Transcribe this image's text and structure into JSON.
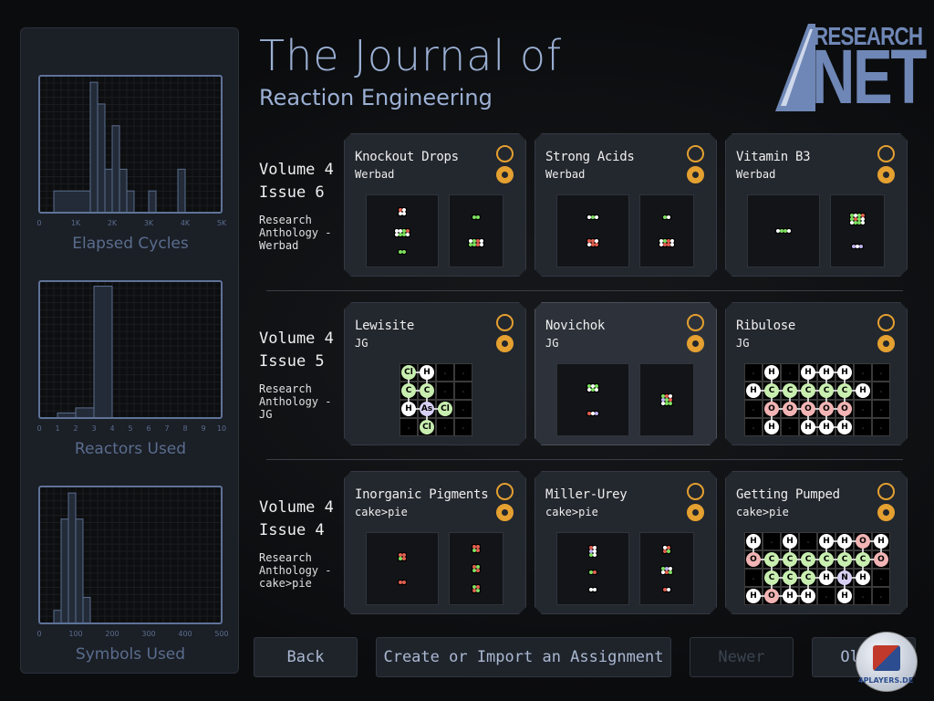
{
  "header": {
    "title": "The Journal of",
    "subtitle": "Reaction Engineering",
    "logo_top": "RESEARCH",
    "logo_bottom": "NET"
  },
  "chart_data": [
    {
      "type": "bar",
      "title": "Elapsed Cycles",
      "xlim": [
        0,
        5000
      ],
      "ylim": [
        0,
        6.3
      ],
      "xticks": [
        "0",
        "1K",
        "2K",
        "3K",
        "4K",
        "5K"
      ],
      "grid": true,
      "bins": [
        [
          400,
          1400,
          1
        ],
        [
          1400,
          1600,
          6
        ],
        [
          1600,
          1800,
          5
        ],
        [
          1800,
          2000,
          2
        ],
        [
          2000,
          2200,
          4
        ],
        [
          2200,
          2400,
          2
        ],
        [
          2400,
          2600,
          1
        ],
        [
          3000,
          3200,
          1
        ],
        [
          3800,
          4000,
          2
        ]
      ]
    },
    {
      "type": "bar",
      "title": "Reactors Used",
      "xlim": [
        0,
        10
      ],
      "ylim": [
        0,
        27
      ],
      "xticks": [
        "0",
        "1",
        "2",
        "3",
        "4",
        "5",
        "6",
        "7",
        "8",
        "9",
        "10"
      ],
      "grid": true,
      "bins": [
        [
          1,
          2,
          1
        ],
        [
          2,
          3,
          2
        ],
        [
          3,
          4,
          26
        ]
      ]
    },
    {
      "type": "bar",
      "title": "Symbols Used",
      "xlim": [
        0,
        500
      ],
      "ylim": [
        0,
        10.5
      ],
      "xticks": [
        "0",
        "100",
        "200",
        "300",
        "400",
        "500"
      ],
      "grid": true,
      "bins": [
        [
          40,
          60,
          1
        ],
        [
          60,
          80,
          8
        ],
        [
          80,
          100,
          10
        ],
        [
          100,
          120,
          8
        ],
        [
          120,
          140,
          2
        ]
      ]
    }
  ],
  "colors": {
    "accent": "#e4a030",
    "H": "#ffffff",
    "C": "#c8eeb0",
    "O": "#f2b4b4",
    "Cl": "#c8eeb0",
    "As": "#d8d0f4",
    "N": "#d8d0f4"
  },
  "issues": [
    {
      "volume": "Volume 4",
      "issue": "Issue 6",
      "anthology": "Research Anthology - Werbad",
      "cards": [
        {
          "title": "Knockout Drops",
          "author": "Werbad",
          "inputs": [
            [
              "rw",
              "ww"
            ],
            [
              "wwgr",
              "wggw"
            ],
            [
              "gg"
            ]
          ],
          "outputs": [
            [
              "gg"
            ],
            [
              "wgrw",
              "ggrw"
            ]
          ]
        },
        {
          "title": "Strong Acids",
          "author": "Werbad",
          "inputs": [
            [
              "wgw"
            ],
            [
              "rrw",
              "wrr"
            ]
          ],
          "outputs": [
            [
              "gw"
            ],
            [
              "wgrw",
              "wrrw"
            ]
          ]
        },
        {
          "title": "Vitamin B3",
          "author": "Werbad",
          "inputs": [
            [
              "wggw"
            ]
          ],
          "outputs": [
            [
              "gwgr",
              "grgw",
              "wggw"
            ],
            [
              "pwp"
            ]
          ]
        }
      ]
    },
    {
      "volume": "Volume 4",
      "issue": "Issue 5",
      "anthology": "Research Anthology - JG",
      "cards": [
        {
          "title": "Lewisite",
          "author": "JG",
          "grid_cols": 4,
          "molecule": [
            "Cl H . .",
            "C C . .",
            "H As Cl .",
            ". Cl . ."
          ]
        },
        {
          "title": "Novichok",
          "author": "JG",
          "selected": true,
          "inputs": [
            [
              "gwg",
              "wgw"
            ],
            [
              "rwp"
            ]
          ],
          "outputs": [
            [
              "grw",
              "pgr",
              "wgg"
            ]
          ]
        },
        {
          "title": "Ribulose",
          "author": "JG",
          "grid_cols": 8,
          "molecule": [
            ". H . H H H . .",
            "H C C C C C H .",
            ". O O O O O . .",
            ". H . H H H . ."
          ]
        }
      ]
    },
    {
      "volume": "Volume 4",
      "issue": "Issue 4",
      "anthology": "Research Anthology - cake>pie",
      "cards": [
        {
          "title": "Inorganic Pigments",
          "author": "cake>pie",
          "inputs": [
            [
              "rr",
              "gr"
            ],
            [
              "rr"
            ]
          ],
          "outputs": [
            [
              "rr",
              "gr"
            ],
            [
              "rg",
              "gr"
            ],
            [
              "gr",
              "rg"
            ]
          ]
        },
        {
          "title": "Miller-Urey",
          "author": "cake>pie",
          "inputs": [
            [
              "rw",
              "pw",
              "gw"
            ],
            [
              "gr"
            ],
            [
              "ww"
            ]
          ],
          "outputs": [
            [
              "wr",
              "rg"
            ],
            [
              "gpw",
              "wrg"
            ],
            [
              "rw"
            ]
          ]
        },
        {
          "title": "Getting Pumped",
          "author": "cake>pie",
          "grid_cols": 8,
          "molecule": [
            "H . H . H H O H",
            "O C C C C C C O",
            ". C C C H N H .",
            "H O H H . H . ."
          ]
        }
      ]
    }
  ],
  "buttons": {
    "back": "Back",
    "create": "Create or Import an Assignment",
    "newer": "Newer",
    "older": "Older"
  },
  "watermark": "4PLAYERS.DE"
}
